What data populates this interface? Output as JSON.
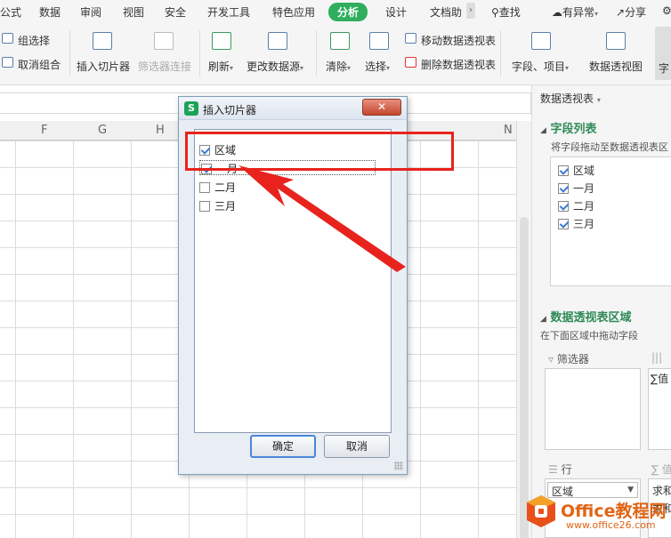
{
  "menu": {
    "tabs": [
      "公式",
      "数据",
      "审阅",
      "视图",
      "安全",
      "开发工具",
      "特色应用",
      "分析",
      "设计",
      "文档助"
    ],
    "active_tab": "分析",
    "more": "›",
    "search": "查找",
    "status": "有异常",
    "share": "分享"
  },
  "ribbon": {
    "group_select": "组选择",
    "ungroup": "取消组合",
    "insert_slicer": "插入切片器",
    "filter_connections": "筛选器连接",
    "refresh": "刷新",
    "change_source": "更改数据源",
    "clear": "清除",
    "select": "选择",
    "move_pivot": "移动数据透视表",
    "delete_pivot": "删除数据透视表",
    "fields_items": "字段、项目",
    "pivot_chart": "数据透视图",
    "cut_label": "字"
  },
  "columns": [
    "F",
    "G",
    "H",
    "N"
  ],
  "pane": {
    "title": "数据透视表",
    "field_list_title": "字段列表",
    "field_list_hint": "将字段拖动至数据透视表区",
    "fields": [
      {
        "label": "区域",
        "checked": true
      },
      {
        "label": "一月",
        "checked": true
      },
      {
        "label": "二月",
        "checked": true
      },
      {
        "label": "三月",
        "checked": true
      }
    ],
    "area_title": "数据透视表区域",
    "area_hint": "在下面区域中拖动字段",
    "filter_label": "筛选器",
    "values_chip": "∑值",
    "rows_label": "行",
    "rows_value": "区域",
    "sum_label_1": "求和",
    "sum_label_2": "求和"
  },
  "dialog": {
    "title": "插入切片器",
    "logo": "S",
    "close": "✕",
    "items": [
      {
        "label": "区域",
        "checked": true
      },
      {
        "label": "一月",
        "checked": true
      },
      {
        "label": "二月",
        "checked": false
      },
      {
        "label": "三月",
        "checked": false
      }
    ],
    "ok": "确定",
    "cancel": "取消"
  },
  "watermark": {
    "brand": "Office教程网",
    "url": "www.office26.com"
  },
  "colors": {
    "accent_green": "#2fae5e",
    "highlight_red": "#e8231d",
    "watermark_orange": "#e06515"
  }
}
